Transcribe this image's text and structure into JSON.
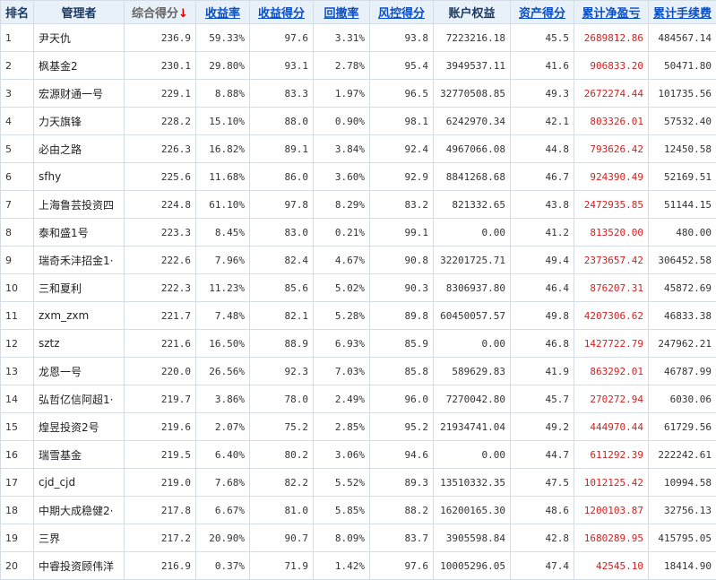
{
  "columns": [
    {
      "key": "rank",
      "label": "排名"
    },
    {
      "key": "manager",
      "label": "管理者"
    },
    {
      "key": "score",
      "label": "综合得分",
      "sort_arrow": "↓"
    },
    {
      "key": "return_rate",
      "label": "收益率"
    },
    {
      "key": "return_score",
      "label": "收益得分"
    },
    {
      "key": "drawdown",
      "label": "回撤率"
    },
    {
      "key": "risk_score",
      "label": "风控得分"
    },
    {
      "key": "equity",
      "label": "账户权益"
    },
    {
      "key": "asset_score",
      "label": "资产得分"
    },
    {
      "key": "net_pnl",
      "label": "累计净盈亏"
    },
    {
      "key": "fees",
      "label": "累计手续费"
    }
  ],
  "rows": [
    {
      "rank": "1",
      "manager": "尹天仇",
      "score": "236.9",
      "return_rate": "59.33%",
      "return_score": "97.6",
      "drawdown": "3.31%",
      "risk_score": "93.8",
      "equity": "7223216.18",
      "asset_score": "45.5",
      "net_pnl": "2689812.86",
      "fees": "484567.14"
    },
    {
      "rank": "2",
      "manager": "枫基金2",
      "score": "230.1",
      "return_rate": "29.80%",
      "return_score": "93.1",
      "drawdown": "2.78%",
      "risk_score": "95.4",
      "equity": "3949537.11",
      "asset_score": "41.6",
      "net_pnl": "906833.20",
      "fees": "50471.80"
    },
    {
      "rank": "3",
      "manager": "宏源财通一号",
      "score": "229.1",
      "return_rate": "8.88%",
      "return_score": "83.3",
      "drawdown": "1.97%",
      "risk_score": "96.5",
      "equity": "32770508.85",
      "asset_score": "49.3",
      "net_pnl": "2672274.44",
      "fees": "101735.56"
    },
    {
      "rank": "4",
      "manager": "力天旗锋",
      "score": "228.2",
      "return_rate": "15.10%",
      "return_score": "88.0",
      "drawdown": "0.90%",
      "risk_score": "98.1",
      "equity": "6242970.34",
      "asset_score": "42.1",
      "net_pnl": "803326.01",
      "fees": "57532.40"
    },
    {
      "rank": "5",
      "manager": "必由之路",
      "score": "226.3",
      "return_rate": "16.82%",
      "return_score": "89.1",
      "drawdown": "3.84%",
      "risk_score": "92.4",
      "equity": "4967066.08",
      "asset_score": "44.8",
      "net_pnl": "793626.42",
      "fees": "12450.58"
    },
    {
      "rank": "6",
      "manager": "sfhy",
      "score": "225.6",
      "return_rate": "11.68%",
      "return_score": "86.0",
      "drawdown": "3.60%",
      "risk_score": "92.9",
      "equity": "8841268.68",
      "asset_score": "46.7",
      "net_pnl": "924390.49",
      "fees": "52169.51"
    },
    {
      "rank": "7",
      "manager": "上海鲁芸投资四",
      "score": "224.8",
      "return_rate": "61.10%",
      "return_score": "97.8",
      "drawdown": "8.29%",
      "risk_score": "83.2",
      "equity": "821332.65",
      "asset_score": "43.8",
      "net_pnl": "2472935.85",
      "fees": "51144.15"
    },
    {
      "rank": "8",
      "manager": "泰和盛1号",
      "score": "223.3",
      "return_rate": "8.45%",
      "return_score": "83.0",
      "drawdown": "0.21%",
      "risk_score": "99.1",
      "equity": "0.00",
      "asset_score": "41.2",
      "net_pnl": "813520.00",
      "fees": "480.00"
    },
    {
      "rank": "9",
      "manager": "瑞奇禾沣招金1·",
      "score": "222.6",
      "return_rate": "7.96%",
      "return_score": "82.4",
      "drawdown": "4.67%",
      "risk_score": "90.8",
      "equity": "32201725.71",
      "asset_score": "49.4",
      "net_pnl": "2373657.42",
      "fees": "306452.58"
    },
    {
      "rank": "10",
      "manager": "三和夏利",
      "score": "222.3",
      "return_rate": "11.23%",
      "return_score": "85.6",
      "drawdown": "5.02%",
      "risk_score": "90.3",
      "equity": "8306937.80",
      "asset_score": "46.4",
      "net_pnl": "876207.31",
      "fees": "45872.69"
    },
    {
      "rank": "11",
      "manager": "zxm_zxm",
      "score": "221.7",
      "return_rate": "7.48%",
      "return_score": "82.1",
      "drawdown": "5.28%",
      "risk_score": "89.8",
      "equity": "60450057.57",
      "asset_score": "49.8",
      "net_pnl": "4207306.62",
      "fees": "46833.38"
    },
    {
      "rank": "12",
      "manager": "sztz",
      "score": "221.6",
      "return_rate": "16.50%",
      "return_score": "88.9",
      "drawdown": "6.93%",
      "risk_score": "85.9",
      "equity": "0.00",
      "asset_score": "46.8",
      "net_pnl": "1427722.79",
      "fees": "247962.21"
    },
    {
      "rank": "13",
      "manager": "龙恩一号",
      "score": "220.0",
      "return_rate": "26.56%",
      "return_score": "92.3",
      "drawdown": "7.03%",
      "risk_score": "85.8",
      "equity": "589629.83",
      "asset_score": "41.9",
      "net_pnl": "863292.01",
      "fees": "46787.99"
    },
    {
      "rank": "14",
      "manager": "弘哲亿信阿超1·",
      "score": "219.7",
      "return_rate": "3.86%",
      "return_score": "78.0",
      "drawdown": "2.49%",
      "risk_score": "96.0",
      "equity": "7270042.80",
      "asset_score": "45.7",
      "net_pnl": "270272.94",
      "fees": "6030.06"
    },
    {
      "rank": "15",
      "manager": "煌昱投资2号",
      "score": "219.6",
      "return_rate": "2.07%",
      "return_score": "75.2",
      "drawdown": "2.85%",
      "risk_score": "95.2",
      "equity": "21934741.04",
      "asset_score": "49.2",
      "net_pnl": "444970.44",
      "fees": "61729.56"
    },
    {
      "rank": "16",
      "manager": "瑞雪基金",
      "score": "219.5",
      "return_rate": "6.40%",
      "return_score": "80.2",
      "drawdown": "3.06%",
      "risk_score": "94.6",
      "equity": "0.00",
      "asset_score": "44.7",
      "net_pnl": "611292.39",
      "fees": "222242.61"
    },
    {
      "rank": "17",
      "manager": "cjd_cjd",
      "score": "219.0",
      "return_rate": "7.68%",
      "return_score": "82.2",
      "drawdown": "5.52%",
      "risk_score": "89.3",
      "equity": "13510332.35",
      "asset_score": "47.5",
      "net_pnl": "1012125.42",
      "fees": "10994.58"
    },
    {
      "rank": "18",
      "manager": "中期大成稳健2·",
      "score": "217.8",
      "return_rate": "6.67%",
      "return_score": "81.0",
      "drawdown": "5.85%",
      "risk_score": "88.2",
      "equity": "16200165.30",
      "asset_score": "48.6",
      "net_pnl": "1200103.87",
      "fees": "32756.13"
    },
    {
      "rank": "19",
      "manager": "三界",
      "score": "217.2",
      "return_rate": "20.90%",
      "return_score": "90.7",
      "drawdown": "8.09%",
      "risk_score": "83.7",
      "equity": "3905598.84",
      "asset_score": "42.8",
      "net_pnl": "1680289.95",
      "fees": "415795.05"
    },
    {
      "rank": "20",
      "manager": "中睿投资顾伟洋",
      "score": "216.9",
      "return_rate": "0.37%",
      "return_score": "71.9",
      "drawdown": "1.42%",
      "risk_score": "97.6",
      "equity": "10005296.05",
      "asset_score": "47.4",
      "net_pnl": "42545.10",
      "fees": "18414.90"
    }
  ],
  "colors": {
    "header_bg": "#e8f0f8",
    "link_blue": "#0a4fc8",
    "pnl_red": "#d42020",
    "sort_arrow_red": "#d40000",
    "border": "#d4dde6"
  }
}
